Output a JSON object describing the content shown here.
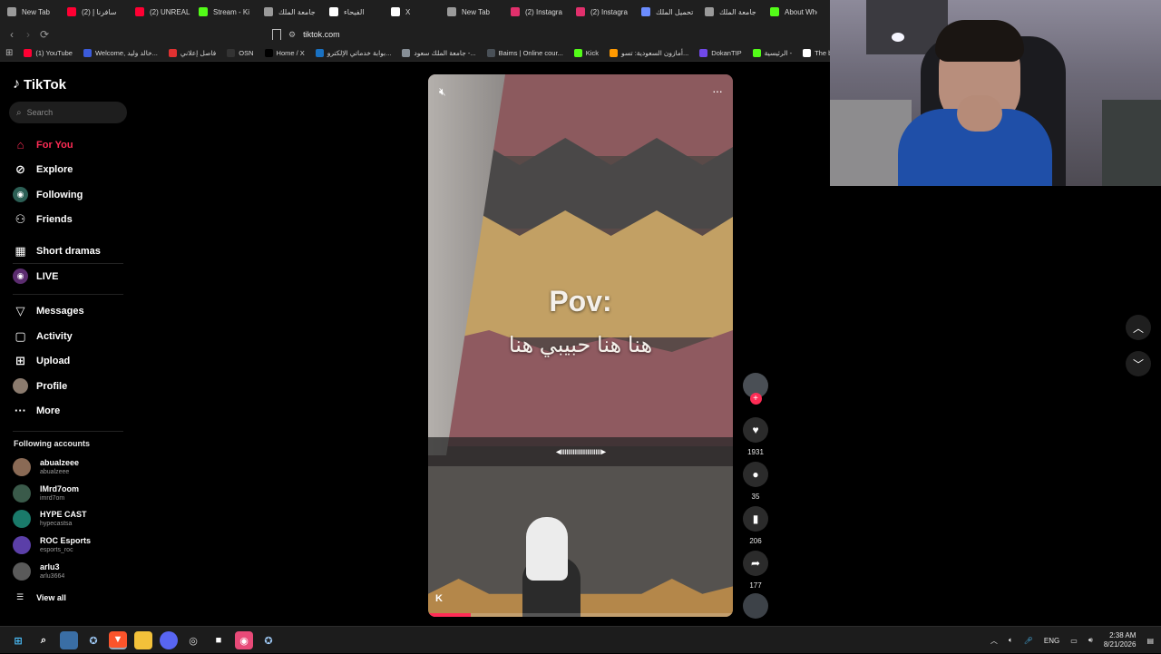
{
  "tabs": [
    {
      "label": "New Tab",
      "icon": "shield-icon",
      "color": "#9a9a9a"
    },
    {
      "label": "(2) سافرنا إ",
      "icon": "youtube-icon",
      "color": "#ff0033"
    },
    {
      "label": "(2) UNREAL",
      "icon": "youtube-icon",
      "color": "#ff0033"
    },
    {
      "label": "Stream - Ki",
      "icon": "kick-icon",
      "color": "#53fc18"
    },
    {
      "label": "جامعة الملك",
      "icon": "globe-icon",
      "color": "#9a9a9a"
    },
    {
      "label": "الفيحاء",
      "icon": "drop-icon",
      "color": "#ffffff"
    },
    {
      "label": "X",
      "icon": "x-icon",
      "color": "#ffffff"
    },
    {
      "label": "New Tab",
      "icon": "shield-icon",
      "color": "#9a9a9a"
    },
    {
      "label": "(2) Instagra",
      "icon": "instagram-icon",
      "color": "#e1306c"
    },
    {
      "label": "(2) Instagra",
      "icon": "instagram-icon",
      "color": "#e1306c"
    },
    {
      "label": "تحميل الملك",
      "icon": "diamond-icon",
      "color": "#6b8cff"
    },
    {
      "label": "جامعة الملك",
      "icon": "globe-icon",
      "color": "#9a9a9a"
    },
    {
      "label": "About Whe",
      "icon": "kick-icon",
      "color": "#53fc18"
    }
  ],
  "address": {
    "url": "tiktok.com"
  },
  "bookmarks": [
    {
      "label": "(1) YouTube",
      "color": "#ff0033"
    },
    {
      "label": "Welcome, خالد وليد...",
      "color": "#3b5bdb"
    },
    {
      "label": "فاصل إعلاني",
      "color": "#e03131"
    },
    {
      "label": "OSN",
      "color": "#333333"
    },
    {
      "label": "Home / X",
      "color": "#000000"
    },
    {
      "label": "بوابة خدماتي الإلكترو...",
      "color": "#1971c2"
    },
    {
      "label": "جامعة الملك سعود -...",
      "color": "#868e96"
    },
    {
      "label": "Baims | Online cour...",
      "color": "#495057"
    },
    {
      "label": "Kick",
      "color": "#53fc18"
    },
    {
      "label": "أمازون السعودية: تسو...",
      "color": "#ff9900"
    },
    {
      "label": "DokanTIP",
      "color": "#7048e8"
    },
    {
      "label": "الرئيسية -",
      "color": "#53fc18"
    },
    {
      "label": "The best Ch",
      "color": "#ffffff"
    }
  ],
  "tiktok": {
    "logo": "TikTok",
    "search_placeholder": "Search",
    "nav": [
      {
        "label": "For You",
        "icon": "home-icon",
        "active": true
      },
      {
        "label": "Explore",
        "icon": "compass-icon"
      },
      {
        "label": "Following",
        "icon": "following-icon"
      },
      {
        "label": "Friends",
        "icon": "friends-icon"
      },
      {
        "label": "Short dramas",
        "icon": "dramas-icon"
      },
      {
        "label": "LIVE",
        "icon": "live-icon"
      },
      {
        "label": "Messages",
        "icon": "messages-icon"
      },
      {
        "label": "Activity",
        "icon": "activity-icon"
      },
      {
        "label": "Upload",
        "icon": "upload-icon"
      },
      {
        "label": "Profile",
        "icon": "profile-icon"
      },
      {
        "label": "More",
        "icon": "more-icon"
      }
    ],
    "following_title": "Following accounts",
    "accounts": [
      {
        "name": "abualzeee",
        "handle": "abualzeee",
        "color": "#8a6a55"
      },
      {
        "name": "IMrd7oom",
        "handle": "imrd7om",
        "color": "#3a5a4a"
      },
      {
        "name": "HYPE CAST",
        "handle": "hypecastsa",
        "color": "#1a7a6a"
      },
      {
        "name": "ROC Esports",
        "handle": "esports_roc",
        "color": "#5b3fa8"
      },
      {
        "name": "arlu3",
        "handle": "arlu3664",
        "color": "#5a5a5a"
      }
    ],
    "view_all": "View all"
  },
  "video": {
    "caption_title": "Pov:",
    "caption_arabic": "هنا هنا حبيبي هنا",
    "waveform": "◂ıııııııııııııııııııııııııı▸",
    "watermark": "K",
    "progress": 0.14
  },
  "actions": {
    "likes": "1931",
    "comments": "35",
    "saves": "206",
    "shares": "177"
  },
  "taskbar": {
    "lang": "ENG",
    "time": "2:38 AM",
    "date": "8/21/2026"
  }
}
